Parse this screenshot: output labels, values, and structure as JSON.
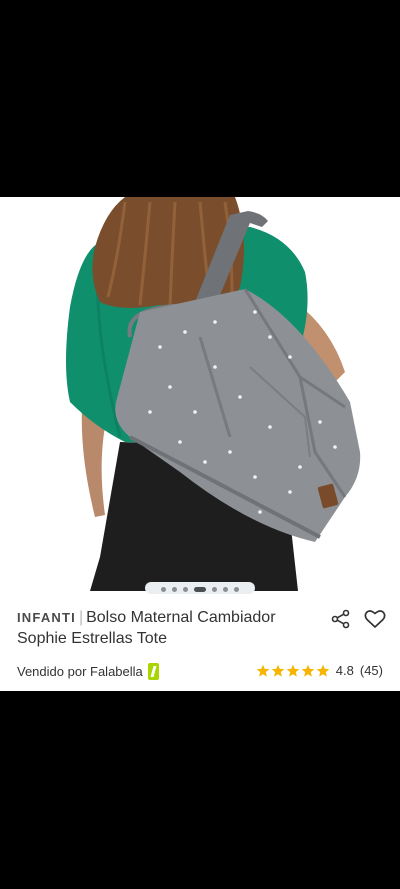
{
  "product": {
    "brand": "INFANTI",
    "title": "Bolso Maternal Cambiador Sophie Estrellas Tote",
    "image_alt": "Mujer con blusa verde llevando un bolso maternal gris con estrellas blancas al hombro"
  },
  "carousel": {
    "total": 7,
    "active_index": 3
  },
  "seller": {
    "label": "Vendido por Falabella"
  },
  "rating": {
    "value": "4.8",
    "count": "(45)",
    "stars": 5
  },
  "colors": {
    "star": "#f7b500",
    "badge": "#aad500",
    "bag": "#8d9195",
    "shirt": "#0f8f6c"
  },
  "icons": {
    "share": "share-icon",
    "wishlist": "heart-icon"
  }
}
